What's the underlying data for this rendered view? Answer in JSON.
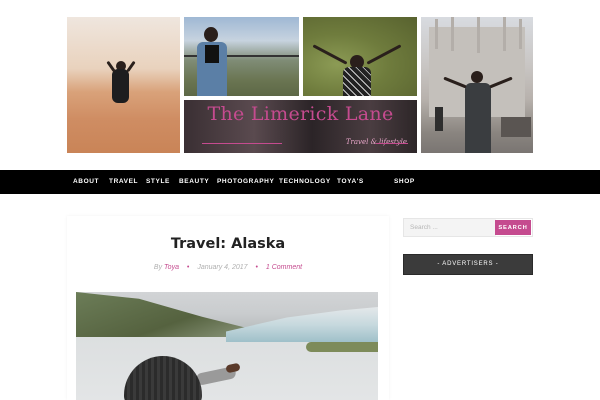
{
  "header": {
    "brand_title": "The Limerick Lane",
    "brand_tagline": "Travel & lifestyle",
    "brand_color": "#c54b8f"
  },
  "nav": {
    "items": [
      {
        "label": "About"
      },
      {
        "label": "Travel"
      },
      {
        "label": "Style"
      },
      {
        "label": "Beauty"
      },
      {
        "label": "Photography"
      },
      {
        "label": "Technology"
      },
      {
        "label": "Toya's"
      },
      {
        "label": "Shop"
      }
    ]
  },
  "post": {
    "title": "Travel: Alaska",
    "meta": {
      "by_prefix": "By",
      "author": "Toya",
      "date": "January 4, 2017",
      "comments": "1 Comment",
      "separator": "•"
    },
    "image_icon": "post-photo"
  },
  "sidebar": {
    "search": {
      "placeholder": "Search ...",
      "button_label": "Search"
    },
    "advertisers_label": "- Advertisers -"
  }
}
